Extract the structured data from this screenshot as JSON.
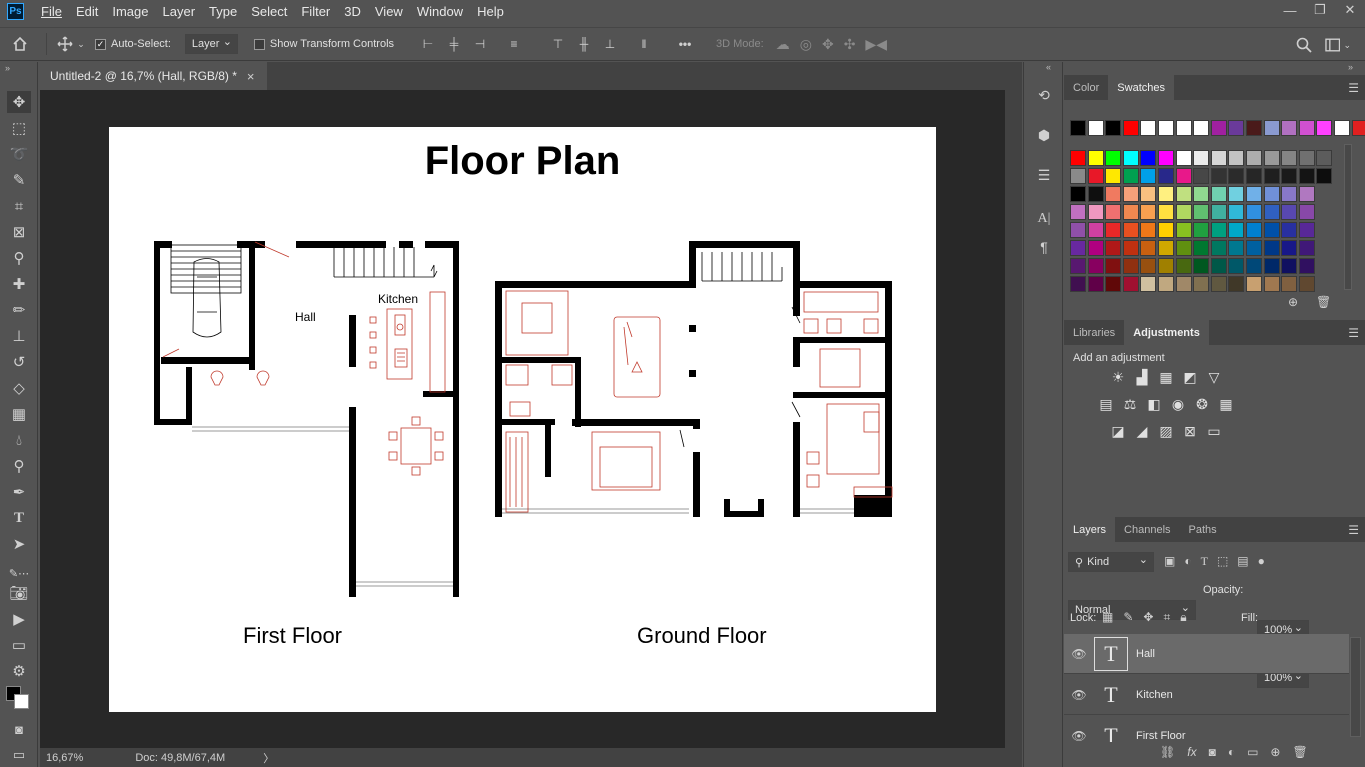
{
  "app": {
    "logo": "Ps",
    "menus": [
      "File",
      "Edit",
      "Image",
      "Layer",
      "Type",
      "Select",
      "Filter",
      "3D",
      "View",
      "Window",
      "Help"
    ],
    "window_controls": [
      "minimize-icon",
      "restore-icon",
      "close-icon"
    ]
  },
  "options": {
    "auto_select_label": "Auto-Select:",
    "auto_select_checked": true,
    "auto_select_target": "Layer",
    "transform_controls_label": "Show Transform Controls",
    "transform_controls_checked": false,
    "mode_3d_label": "3D Mode:"
  },
  "document": {
    "tab_title": "Untitled-2 @ 16,7% (Hall, RGB/8) *",
    "close_glyph": "×",
    "title": "Floor Plan",
    "first_floor_label": "First Floor",
    "ground_floor_label": "Ground Floor",
    "hall_label": "Hall",
    "kitchen_label": "Kitchen"
  },
  "status": {
    "zoom": "16,67%",
    "doc_size": "Doc: 49,8M/67,4M",
    "arrow": "〉"
  },
  "color_panel": {
    "tabs": [
      "Color",
      "Swatches"
    ],
    "active_tab": "Swatches"
  },
  "adjustments_panel": {
    "tabs": [
      "Libraries",
      "Adjustments"
    ],
    "active_tab": "Adjustments",
    "hint": "Add an adjustment"
  },
  "layers_panel": {
    "tabs": [
      "Layers",
      "Channels",
      "Paths"
    ],
    "active_tab": "Layers",
    "filter_kind": "Kind",
    "blend_mode": "Normal",
    "opacity_label": "Opacity:",
    "opacity_value": "100%",
    "lock_label": "Lock:",
    "fill_label": "Fill:",
    "fill_value": "100%",
    "thumb_glyph": "T",
    "layers": [
      {
        "name": "Hall",
        "selected": true
      },
      {
        "name": "Kitchen",
        "selected": false
      },
      {
        "name": "First Floor",
        "selected": false
      }
    ]
  }
}
